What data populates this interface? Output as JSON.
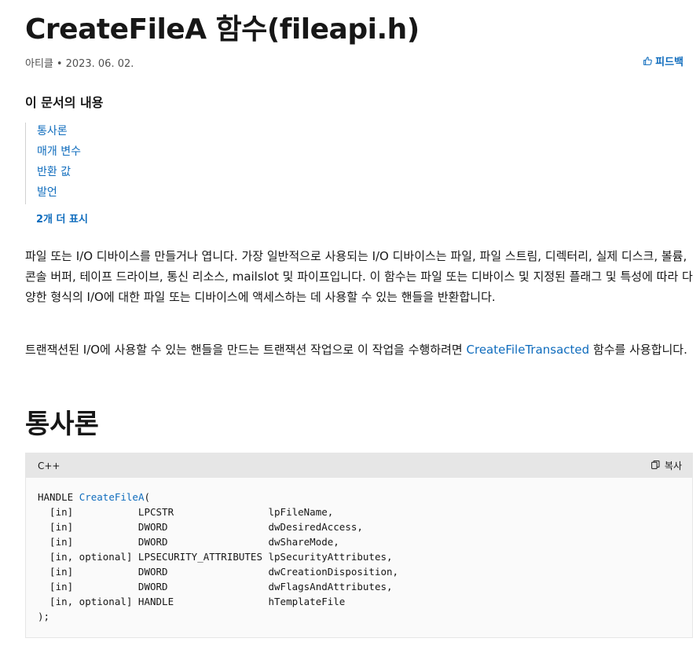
{
  "header": {
    "title": "CreateFileA 함수(fileapi.h)",
    "article_label": "아티클",
    "separator": "•",
    "date": "2023. 06. 02.",
    "feedback_label": "피드백"
  },
  "toc": {
    "heading": "이 문서의 내용",
    "items": [
      {
        "label": "통사론"
      },
      {
        "label": "매개 변수"
      },
      {
        "label": "반환 값"
      },
      {
        "label": "발언"
      }
    ],
    "show_more": "2개 더 표시"
  },
  "body": {
    "p1": "파일 또는 I/O 디바이스를 만들거나 엽니다. 가장 일반적으로 사용되는 I/O 디바이스는 파일, 파일 스트림, 디렉터리, 실제 디스크, 볼륨, 콘솔 버퍼, 테이프 드라이브, 통신 리소스, mailslot 및 파이프입니다. 이 함수는 파일 또는 디바이스 및 지정된 플래그 및 특성에 따라 다양한 형식의 I/O에 대한 파일 또는 디바이스에 액세스하는 데 사용할 수 있는 핸들을 반환합니다.",
    "p2_before": "트랜잭션된 I/O에 사용할 수 있는 핸들을 만드는 트랜잭션 작업으로 이 작업을 수행하려면 ",
    "p2_link": "CreateFileTransacted",
    "p2_after": " 함수를 사용합니다."
  },
  "section": {
    "heading": "통사론"
  },
  "code": {
    "language": "C++",
    "copy_label": "복사",
    "line0_type": "HANDLE ",
    "line0_fn": "CreateFileA",
    "line0_tail": "(",
    "lines": [
      "  [in]           LPCSTR                lpFileName,",
      "  [in]           DWORD                 dwDesiredAccess,",
      "  [in]           DWORD                 dwShareMode,",
      "  [in, optional] LPSECURITY_ATTRIBUTES lpSecurityAttributes,",
      "  [in]           DWORD                 dwCreationDisposition,",
      "  [in]           DWORD                 dwFlagsAndAttributes,",
      "  [in, optional] HANDLE                hTemplateFile",
      ");"
    ]
  },
  "icons": {
    "feedback": "thumbs-up-icon",
    "copy": "copy-icon"
  },
  "colors": {
    "link": "#0f6cbd",
    "text": "#171717",
    "code_header_bg": "#e6e6e6",
    "code_bg": "#fafafa"
  }
}
